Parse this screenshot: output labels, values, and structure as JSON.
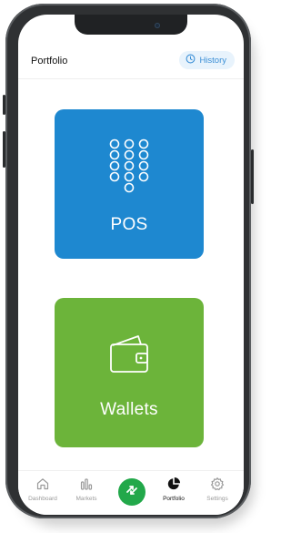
{
  "header": {
    "title": "Portfolio",
    "history_label": "History"
  },
  "tiles": {
    "pos_label": "POS",
    "wallets_label": "Wallets"
  },
  "bottom_nav": {
    "items": [
      {
        "label": "Dashboard",
        "icon": "home-icon"
      },
      {
        "label": "Markets",
        "icon": "bar-chart-icon"
      },
      {
        "label": "",
        "icon": "swap-arrows-icon"
      },
      {
        "label": "Portfolio",
        "icon": "pie-chart-icon",
        "active": true
      },
      {
        "label": "Settings",
        "icon": "gear-icon"
      }
    ]
  },
  "colors": {
    "pos_tile": "#1e88d0",
    "wallets_tile": "#6cb43a",
    "accent": "#3b8fd6",
    "trade_button": "#22a84a"
  }
}
